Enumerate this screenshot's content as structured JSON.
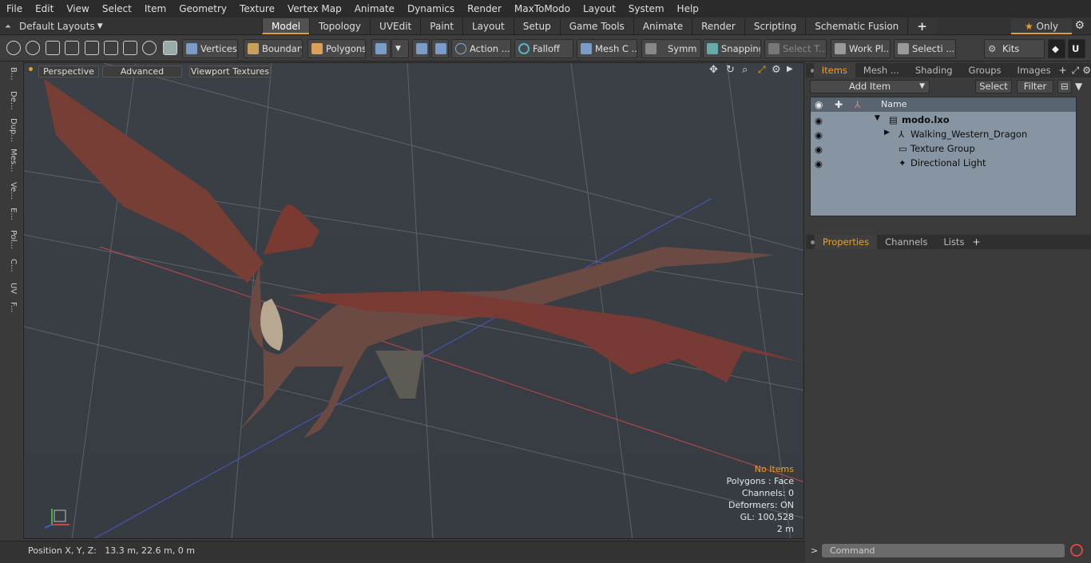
{
  "menu": [
    "File",
    "Edit",
    "View",
    "Select",
    "Item",
    "Geometry",
    "Texture",
    "Vertex Map",
    "Animate",
    "Dynamics",
    "Render",
    "MaxToModo",
    "Layout",
    "System",
    "Help"
  ],
  "layout_selector": "Default Layouts",
  "tabs": [
    "Model",
    "Topology",
    "UVEdit",
    "Paint",
    "Layout",
    "Setup",
    "Game Tools",
    "Animate",
    "Render",
    "Scripting",
    "Schematic Fusion"
  ],
  "only_label": "Only",
  "toolbar": {
    "vertices": "Vertices",
    "boundary": "Boundary",
    "polygons": "Polygons",
    "action": "Action ...",
    "falloff": "Falloff",
    "mesh": "Mesh C ...",
    "symm": "Symm ...",
    "snapping": "Snapping",
    "select_t": "Select T...",
    "work": "Work Pl...",
    "selecti": "Selecti ...",
    "kits": "Kits"
  },
  "left_tabs": [
    "B...",
    "De...",
    "Dup...",
    "Mes...",
    "Ve...",
    "E...",
    "Pol...",
    "C...",
    "UV",
    "F..."
  ],
  "viewport": {
    "perspective": "Perspective",
    "advanced": "Advanced",
    "textures": "Viewport Textures",
    "info": {
      "no_items": "No Items",
      "polygons": "Polygons : Face",
      "channels": "Channels: 0",
      "deformers": "Deformers: ON",
      "gl": "GL: 100,528",
      "scale": "2 m"
    }
  },
  "status": {
    "position": "Position X, Y, Z:   13.3 m, 22.6 m, 0 m"
  },
  "panel_tabs": [
    "Items",
    "Mesh ...",
    "Shading",
    "Groups",
    "Images"
  ],
  "panel": {
    "add_item": "Add Item",
    "select": "Select",
    "filter": "Filter",
    "name_col": "Name"
  },
  "items": [
    "modo.lxo",
    "Walking_Western_Dragon",
    "Texture Group",
    "Directional Light"
  ],
  "props_tabs": [
    "Properties",
    "Channels",
    "Lists"
  ],
  "command_placeholder": "Command",
  "colors": {
    "accent": "#e0a030",
    "viewport_bg": "#3c4248",
    "list_bg": "#8795a3"
  }
}
